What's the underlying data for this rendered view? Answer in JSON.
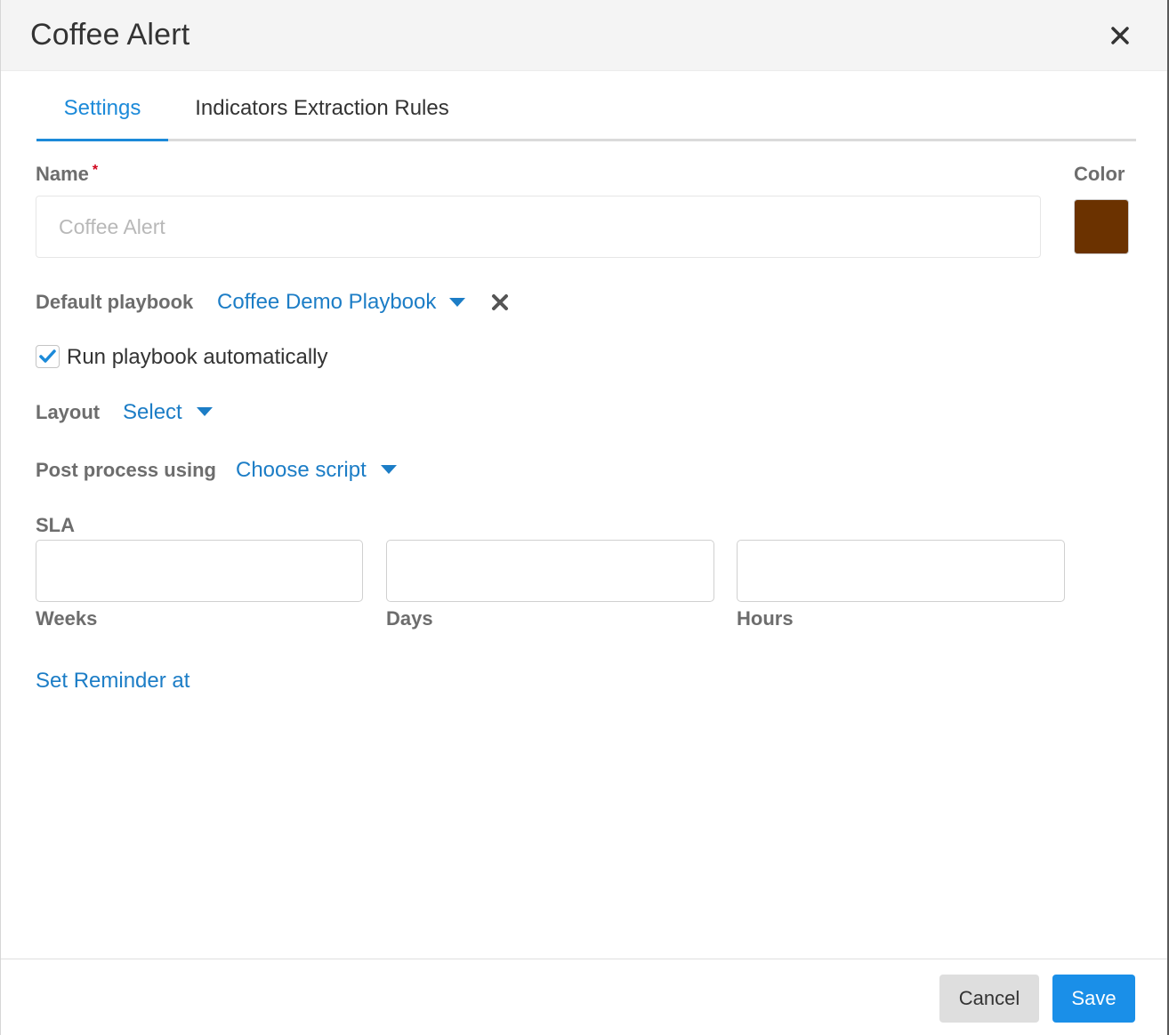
{
  "dialog": {
    "title": "Coffee Alert"
  },
  "tabs": [
    {
      "label": "Settings",
      "active": true
    },
    {
      "label": "Indicators Extraction Rules",
      "active": false
    }
  ],
  "form": {
    "name_label": "Name",
    "name_required_mark": "*",
    "name_placeholder": "Coffee Alert",
    "color_label": "Color",
    "color_value": "#6b3200",
    "default_playbook_label": "Default playbook",
    "default_playbook_value": "Coffee Demo Playbook",
    "run_automatically_label": "Run playbook automatically",
    "run_automatically_checked": true,
    "layout_label": "Layout",
    "layout_value": "Select",
    "post_process_label": "Post process using",
    "post_process_value": "Choose script",
    "sla_label": "SLA",
    "sla_fields": [
      {
        "label": "Weeks",
        "value": ""
      },
      {
        "label": "Days",
        "value": ""
      },
      {
        "label": "Hours",
        "value": ""
      }
    ],
    "reminder_link": "Set Reminder at"
  },
  "footer": {
    "cancel_label": "Cancel",
    "save_label": "Save"
  },
  "colors": {
    "accent": "#1c7dc6",
    "save_button": "#1a8fe8",
    "cancel_button": "#dedede"
  },
  "icons": [
    "close-icon",
    "dropdown-caret-icon",
    "clear-icon",
    "checkmark-icon"
  ]
}
